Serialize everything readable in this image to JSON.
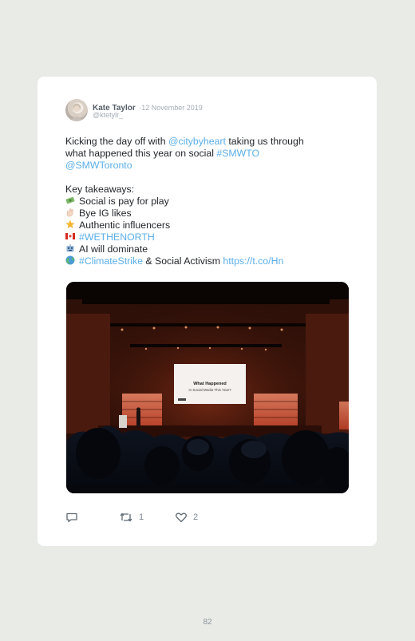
{
  "tweet": {
    "author_name": "Kate Taylor",
    "separator": "·",
    "date": "12 November 2019",
    "handle": "@ktetylr_",
    "line1_pre": "Kicking the day off with ",
    "line1_mention": "@citybyheart",
    "line1_post": " taking us through",
    "line2_pre": "what happened this year on social ",
    "line2_hashtag": "#SMWTO",
    "line3_mention": "@SMWToronto",
    "takeaways_heading": "Key takeaways:",
    "item1": "Social is pay for play",
    "item2": "Bye IG likes",
    "item3": "Authentic influencers",
    "item4": "#WETHENORTH",
    "item5": "AI will dominate",
    "item6_hashtag": "#ClimateStrike",
    "item6_text": " & Social Activism ",
    "item6_link": "https://t.co/Hn",
    "icons": [
      "money-icon",
      "waving-hand-icon",
      "star-icon",
      "canada-flag-icon",
      "robot-icon",
      "globe-icon"
    ]
  },
  "photo": {
    "screen_title": "What Happened",
    "screen_subtitle": "In Social Media This Year?"
  },
  "actions": {
    "retweets": "1",
    "likes": "2"
  },
  "page_number": "82",
  "colors": {
    "background": "#e8ebe6",
    "link": "#5aaee8",
    "text": "#1f2328",
    "muted": "#a3adb6"
  }
}
